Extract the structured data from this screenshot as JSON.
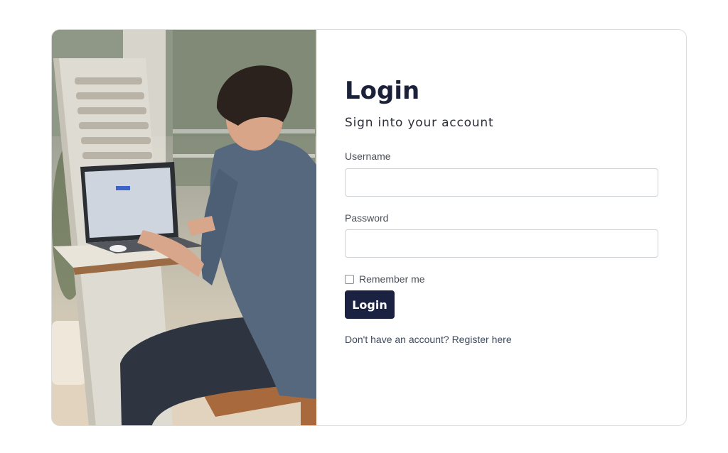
{
  "login": {
    "title": "Login",
    "subtitle": "Sign into your account",
    "username_label": "Username",
    "username_value": "",
    "password_label": "Password",
    "password_value": "",
    "remember_label": "Remember me",
    "remember_checked": false,
    "button_label": "Login",
    "register_prompt": "Don't have an account?",
    "register_link": "Register here"
  },
  "colors": {
    "accent": "#1b2140",
    "title": "#1b2138",
    "text": "#4a5058",
    "border": "#cfd4d9"
  },
  "image": {
    "subject": "person-working-on-laptop"
  }
}
